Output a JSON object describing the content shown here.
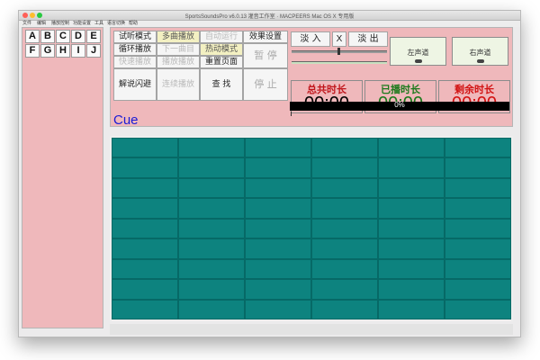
{
  "window": {
    "title": "SportsSoundsPro v6.0.13 灌音工作室 · MACPEERS Mac OS X 专用版"
  },
  "menu": [
    "文件",
    "编辑",
    "播放控制",
    "功能设置",
    "工具",
    "语言切换",
    "帮助"
  ],
  "letters": [
    "A",
    "B",
    "C",
    "D",
    "E",
    "F",
    "G",
    "H",
    "I",
    "J"
  ],
  "buttons": [
    {
      "id": "listen-mode",
      "label": "试听模式",
      "state": "normal"
    },
    {
      "id": "multi-play",
      "label": "多曲播放",
      "state": "highlight"
    },
    {
      "id": "auto-run",
      "label": "自动运行",
      "state": "dim"
    },
    {
      "id": "effects-settings",
      "label": "效果设置",
      "state": "normal"
    },
    {
      "id": "loop-play",
      "label": "循环播放",
      "state": "normal"
    },
    {
      "id": "next-track",
      "label": "下一曲目",
      "state": "dim"
    },
    {
      "id": "hotkey-mode",
      "label": "热动模式",
      "state": "highlight"
    },
    {
      "id": "pause",
      "label": "暂 停",
      "state": "dim"
    },
    {
      "id": "fast-play",
      "label": "快速播放",
      "state": "dim"
    },
    {
      "id": "chain-play",
      "label": "播放播放",
      "state": "dim"
    },
    {
      "id": "reset-page",
      "label": "重置页面",
      "state": "normal"
    },
    {
      "id": "commentary",
      "label": "解说闪避",
      "state": "normal"
    },
    {
      "id": "continuous-play",
      "label": "连续播放",
      "state": "dim"
    },
    {
      "id": "find",
      "label": "查 找",
      "state": "normal"
    },
    {
      "id": "stop",
      "label": "停 止",
      "state": "dim"
    }
  ],
  "fade": {
    "fade_in": "淡 入",
    "x": "X",
    "fade_out": "淡 出"
  },
  "meters": {
    "left": "左声道",
    "right": "右声道"
  },
  "times": {
    "total": {
      "label": "总共时长",
      "value": "00:00",
      "color": "#000000",
      "label_color": "#c0151b"
    },
    "played": {
      "label": "已播时长",
      "value": "00:00",
      "color": "#1b7a1b",
      "label_color": "#1b7a1b"
    },
    "remaining": {
      "label": "剩余时长",
      "value": "00:00",
      "color": "#d21111",
      "label_color": "#d21111"
    }
  },
  "progress": {
    "text": "0%",
    "value": 0
  },
  "cue": "Cue",
  "grid": {
    "rows": 9,
    "cols": 6,
    "color": "#0d837f"
  },
  "colors": {
    "panel": "#efb8bb",
    "cue": "#1a1bd6"
  }
}
